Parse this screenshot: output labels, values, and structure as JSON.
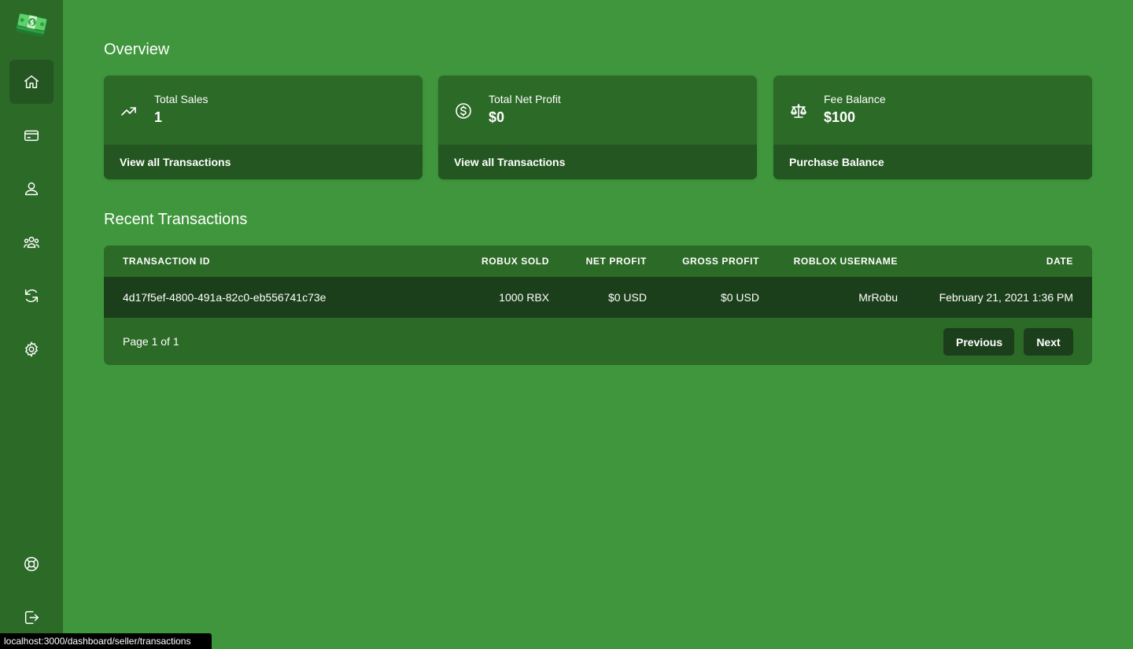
{
  "sidebar": {
    "logo": "money-stack-logo",
    "items": [
      {
        "name": "home",
        "icon": "home-icon",
        "active": true
      },
      {
        "name": "transactions",
        "icon": "credit-card-icon",
        "active": false
      },
      {
        "name": "account",
        "icon": "user-icon",
        "active": false
      },
      {
        "name": "users",
        "icon": "users-group-icon",
        "active": false
      },
      {
        "name": "refresh",
        "icon": "refresh-icon",
        "active": false
      },
      {
        "name": "settings",
        "icon": "gear-icon",
        "active": false
      }
    ],
    "bottom_items": [
      {
        "name": "support",
        "icon": "lifebuoy-icon"
      },
      {
        "name": "logout",
        "icon": "logout-icon"
      }
    ]
  },
  "overview": {
    "title": "Overview",
    "cards": [
      {
        "label": "Total Sales",
        "value": "1",
        "icon": "trending-up-icon",
        "footer": "View all Transactions"
      },
      {
        "label": "Total Net Profit",
        "value": "$0",
        "icon": "dollar-circle-icon",
        "footer": "View all Transactions"
      },
      {
        "label": "Fee Balance",
        "value": "$100",
        "icon": "scale-icon",
        "footer": "Purchase Balance"
      }
    ]
  },
  "transactions": {
    "title": "Recent Transactions",
    "columns": [
      "TRANSACTION ID",
      "ROBUX SOLD",
      "NET PROFIT",
      "GROSS PROFIT",
      "ROBLOX USERNAME",
      "DATE"
    ],
    "rows": [
      [
        "4d17f5ef-4800-491a-82c0-eb556741c73e",
        "1000 RBX",
        "$0 USD",
        "$0 USD",
        "MrRobu",
        "February 21, 2021 1:36 PM"
      ]
    ],
    "page_info": "Page 1 of 1",
    "prev_label": "Previous",
    "next_label": "Next"
  },
  "status_bar": "localhost:3000/dashboard/seller/transactions",
  "colors": {
    "background": "#3f963c",
    "sidebar": "#2c6a27",
    "card": "#2c6a27",
    "card_footer": "#235620",
    "row": "#1c3f1b"
  }
}
